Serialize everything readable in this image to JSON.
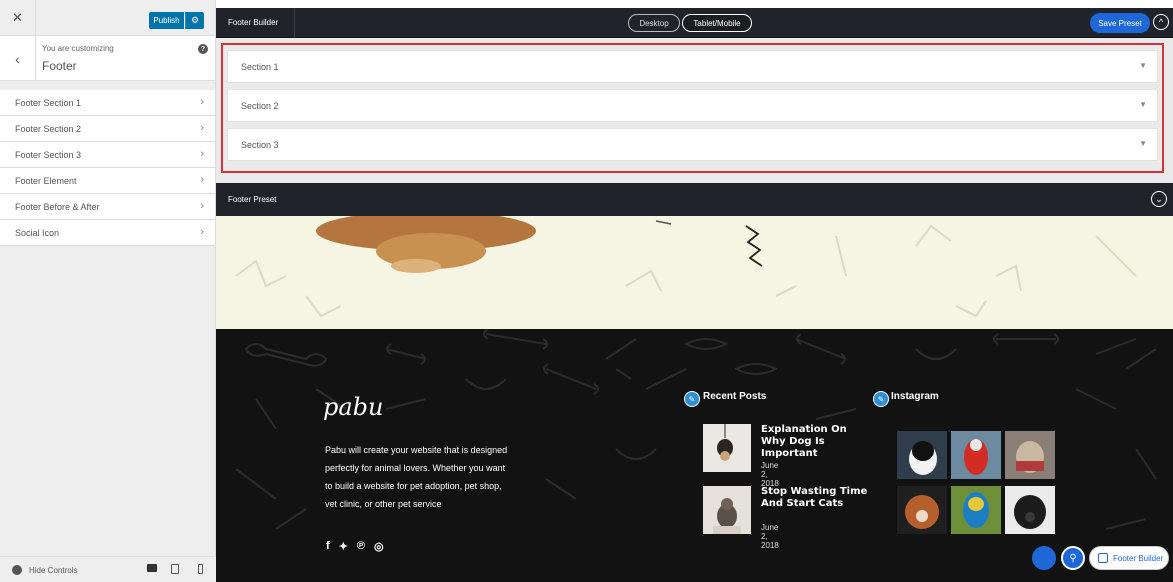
{
  "sidebar": {
    "publish_label": "Publish",
    "customizing_label": "You are customizing",
    "section_title": "Footer",
    "items": [
      {
        "label": "Footer Section 1"
      },
      {
        "label": "Footer Section 2"
      },
      {
        "label": "Footer Section 3"
      },
      {
        "label": "Footer Element"
      },
      {
        "label": "Footer Before & After"
      },
      {
        "label": "Social Icon"
      }
    ],
    "hide_controls_label": "Hide Controls"
  },
  "builder": {
    "title": "Footer Builder",
    "tabs": [
      {
        "label": "Desktop"
      },
      {
        "label": "Tablet/Mobile"
      }
    ],
    "active_tab": "Tablet/Mobile",
    "save_label": "Save Preset",
    "sections": [
      {
        "label": "Section 1"
      },
      {
        "label": "Section 2"
      },
      {
        "label": "Section 3"
      }
    ],
    "preset_title": "Footer Preset"
  },
  "preview": {
    "logo_text": "pabu",
    "about": "Pabu will create your website that is designed perfectly for animal lovers. Whether you want to build a website for pet adoption, pet shop, vet clinic, or other pet service",
    "social_icons": [
      "facebook-icon",
      "twitter-icon",
      "pinterest-icon",
      "instagram-icon"
    ],
    "recent_posts_title": "Recent Posts",
    "posts": [
      {
        "title": "Explanation On Why Dog Is Important",
        "date": "June 2, 2018"
      },
      {
        "title": "Stop Wasting Time And Start Cats",
        "date": "June 2, 2018"
      }
    ],
    "instagram_title": "Instagram"
  },
  "floating": {
    "builder_label": "Footer Builder"
  },
  "colors": {
    "accent_blue": "#1e67d6",
    "wp_blue": "#0073aa",
    "dark_bar": "#20242a",
    "highlight_red": "#d3343a",
    "cream": "#f6f4e2",
    "footer_dark": "#121212"
  }
}
